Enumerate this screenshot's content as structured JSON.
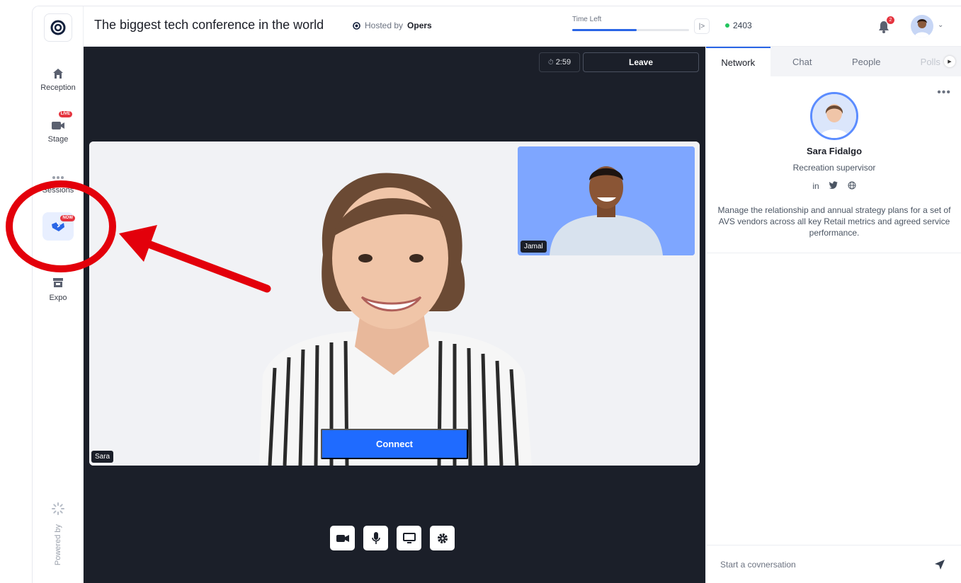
{
  "app": {
    "title": "The biggest tech conference in the world",
    "hosted_prefix": "Hosted by",
    "host": "Opers",
    "time_left_label": "Time Left",
    "time_left_progress": 0.55,
    "online_count": "2403",
    "notification_count": "2",
    "collapse_icon": "|>"
  },
  "nav": {
    "items": [
      {
        "label": "Reception",
        "icon": "home-icon"
      },
      {
        "label": "Stage",
        "icon": "camera-icon",
        "badge": "LIVE"
      },
      {
        "label": "Sessions",
        "icon": "dots-icon"
      },
      {
        "label": "",
        "icon": "handshake-icon",
        "badge": "NOW"
      },
      {
        "label": "Expo",
        "icon": "booth-icon"
      }
    ],
    "powered_by": "Powered by"
  },
  "stage": {
    "timer": "2:59",
    "leave_label": "Leave",
    "main_participant": "Sara",
    "pip_participant": "Jamal",
    "connect_label": "Connect",
    "controls": [
      "camera-icon",
      "microphone-icon",
      "screen-share-icon",
      "settings-icon"
    ]
  },
  "panel": {
    "tabs": [
      {
        "label": "Network",
        "active": true
      },
      {
        "label": "Chat",
        "active": false
      },
      {
        "label": "People",
        "active": false
      },
      {
        "label": "Polls",
        "active": false
      }
    ],
    "profile": {
      "name": "Sara Fidalgo",
      "role": "Recreation supervisor",
      "socials": [
        "in",
        "twitter-icon",
        "globe-icon"
      ],
      "linkedin_text": "in",
      "bio": "Manage the relationship and annual strategy plans for a set of AVS vendors across all key Retail metrics and agreed service performance."
    },
    "compose_placeholder": "Start a covnersation"
  },
  "colors": {
    "accent": "#2a66e6",
    "connect": "#1f6bff",
    "stage_bg": "#1b1f29",
    "badge_red": "#e5343f",
    "annotation_red": "#e3000b",
    "pip_bg": "#7ea6ff",
    "online_green": "#22c55e"
  }
}
